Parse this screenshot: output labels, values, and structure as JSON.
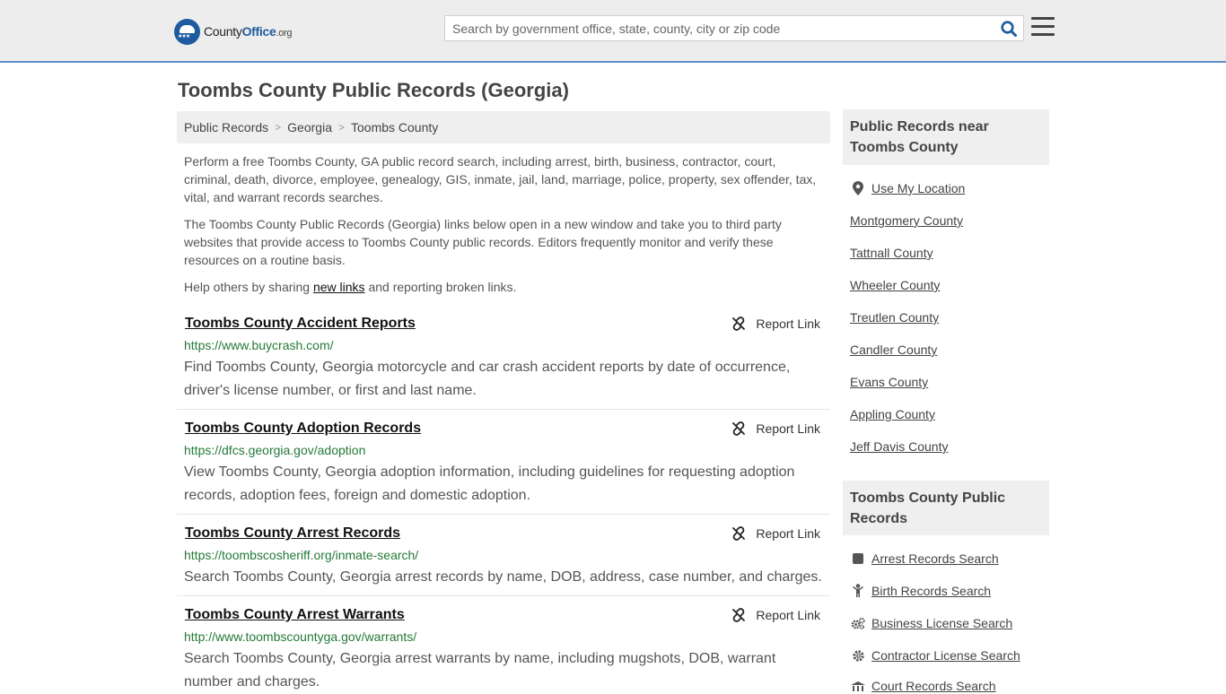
{
  "header": {
    "logo_county": "County",
    "logo_office": "Office",
    "logo_org": ".org",
    "search_placeholder": "Search by government office, state, county, city or zip code"
  },
  "page": {
    "title": "Toombs County Public Records (Georgia)"
  },
  "breadcrumb": [
    "Public Records",
    "Georgia",
    "Toombs County"
  ],
  "intro": {
    "paragraph1": "Perform a free Toombs County, GA public record search, including arrest, birth, business, contractor, court, criminal, death, divorce, employee, genealogy, GIS, inmate, jail, land, marriage, police, property, sex offender, tax, vital, and warrant records searches.",
    "paragraph2": "The Toombs County Public Records (Georgia) links below open in a new window and take you to third party websites that provide access to Toombs County public records. Editors frequently monitor and verify these resources on a routine basis.",
    "help_before": "Help others by sharing ",
    "help_link": "new links",
    "help_after": " and reporting broken links."
  },
  "report_label": "Report Link",
  "entries": [
    {
      "title": "Toombs County Accident Reports",
      "url": "https://www.buycrash.com/",
      "description": "Find Toombs County, Georgia motorcycle and car crash accident reports by date of occurrence, driver's license number, or first and last name."
    },
    {
      "title": "Toombs County Adoption Records",
      "url": "https://dfcs.georgia.gov/adoption",
      "description": "View Toombs County, Georgia adoption information, including guidelines for requesting adoption records, adoption fees, foreign and domestic adoption."
    },
    {
      "title": "Toombs County Arrest Records",
      "url": "https://toombscosheriff.org/inmate-search/",
      "description": "Search Toombs County, Georgia arrest records by name, DOB, address, case number, and charges."
    },
    {
      "title": "Toombs County Arrest Warrants",
      "url": "http://www.toombscountyga.gov/warrants/",
      "description": "Search Toombs County, Georgia arrest warrants by name, including mugshots, DOB, warrant number and charges."
    }
  ],
  "sidebar": {
    "nearby_heading": "Public Records near Toombs County",
    "use_location": "Use My Location",
    "nearby": [
      "Montgomery County",
      "Tattnall County",
      "Wheeler County",
      "Treutlen County",
      "Candler County",
      "Evans County",
      "Appling County",
      "Jeff Davis County"
    ],
    "records_heading": "Toombs County Public Records",
    "records": [
      {
        "label": "Arrest Records Search",
        "icon": "square-icon"
      },
      {
        "label": "Birth Records Search",
        "icon": "child-icon"
      },
      {
        "label": "Business License Search",
        "icon": "gears-icon"
      },
      {
        "label": "Contractor License Search",
        "icon": "gear-icon"
      },
      {
        "label": "Court Records Search",
        "icon": "courthouse-icon"
      }
    ]
  },
  "colors": {
    "accent_line": "#5d8fc9",
    "url_green": "#247a38",
    "logo_blue": "#1e5b9e"
  }
}
